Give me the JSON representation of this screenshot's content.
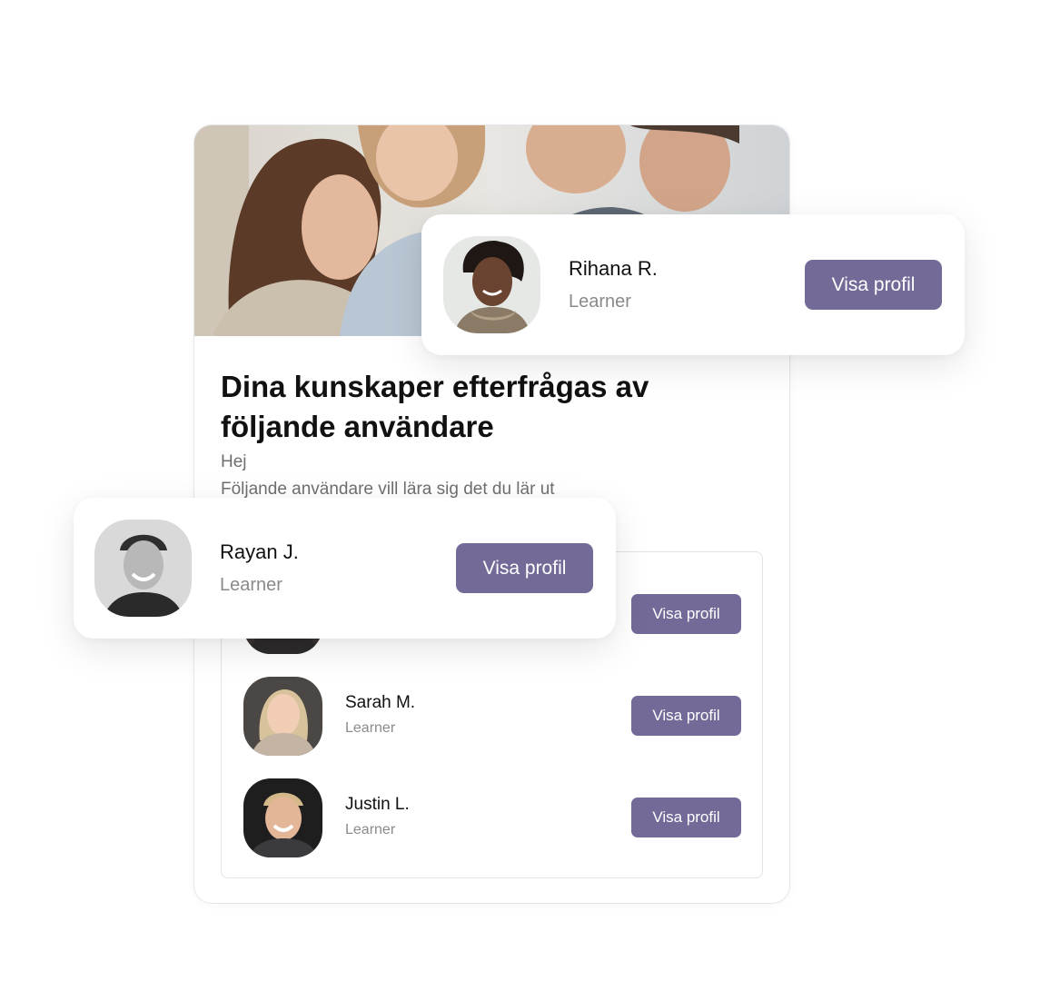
{
  "card": {
    "title": "Dina kunskaper efterfrågas av följande användare",
    "greeting": "Hej",
    "subtitle": "Följande användare vill lära sig det du lär ut"
  },
  "featured_users": [
    {
      "name": "Rihana R.",
      "role": "Learner",
      "button": "Visa profil"
    },
    {
      "name": "Rayan J.",
      "role": "Learner",
      "button": "Visa profil"
    }
  ],
  "list_users": [
    {
      "name": "",
      "role": "",
      "button": "Visa profil"
    },
    {
      "name": "Sarah M.",
      "role": "Learner",
      "button": "Visa profil"
    },
    {
      "name": "Justin L.",
      "role": "Learner",
      "button": "Visa profil"
    }
  ],
  "colors": {
    "accent": "#736a98",
    "muted_text": "#8a8a8a",
    "border": "#e3e3e7"
  }
}
